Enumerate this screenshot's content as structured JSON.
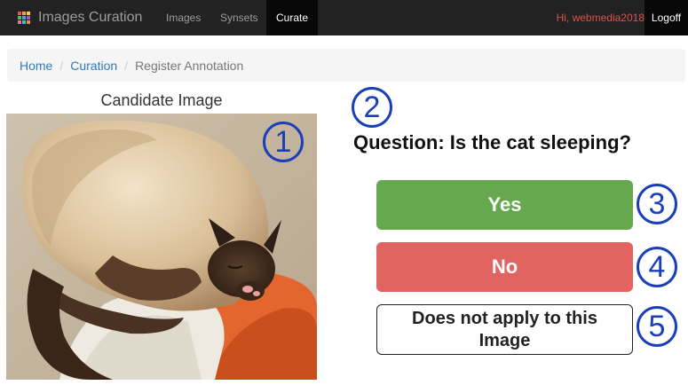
{
  "navbar": {
    "brand": "Images Curation",
    "links": [
      {
        "label": "Images"
      },
      {
        "label": "Synsets"
      },
      {
        "label": "Curate"
      }
    ],
    "greeting": "Hi, webmedia2018",
    "logoff": "Logoff",
    "brand_icon_colors": [
      "#e5534b",
      "#f0a43a",
      "#f4d03f",
      "#5cb85c",
      "#4aa3df",
      "#9b59b6",
      "#e86fa6",
      "#3ec1b8",
      "#f08a4b"
    ]
  },
  "breadcrumb": {
    "items": [
      "Home",
      "Curation",
      "Register Annotation"
    ]
  },
  "candidate": {
    "title": "Candidate Image"
  },
  "question": {
    "text": "Question: Is the cat sleeping?"
  },
  "answers": {
    "yes": "Yes",
    "no": "No",
    "not_applicable": "Does not apply to this Image"
  },
  "markers": [
    "1",
    "2",
    "3",
    "4",
    "5"
  ]
}
